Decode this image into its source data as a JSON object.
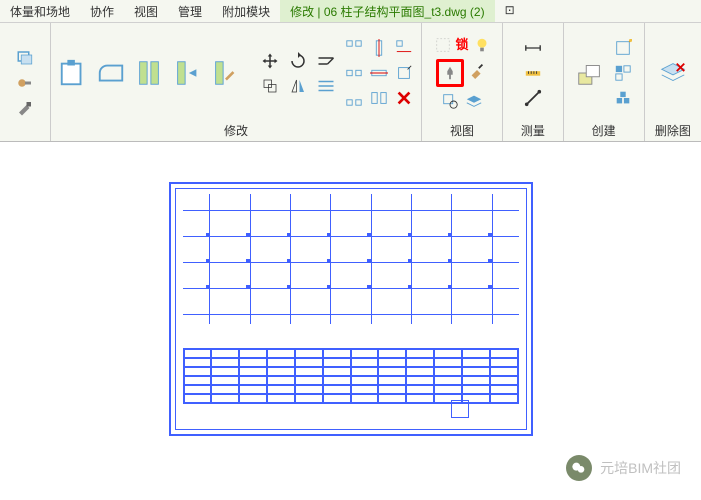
{
  "menu": {
    "items": [
      "体量和场地",
      "协作",
      "视图",
      "管理",
      "附加模块",
      "修改 | 06 柱子结构平面图_t3.dwg (2)",
      "⊡"
    ]
  },
  "ribbon": {
    "lock_label": "锁",
    "panels": {
      "modify": "修改",
      "view": "视图",
      "measure": "测量",
      "create": "创建",
      "delete": "删除图"
    }
  },
  "watermark": "元培BIM社团"
}
